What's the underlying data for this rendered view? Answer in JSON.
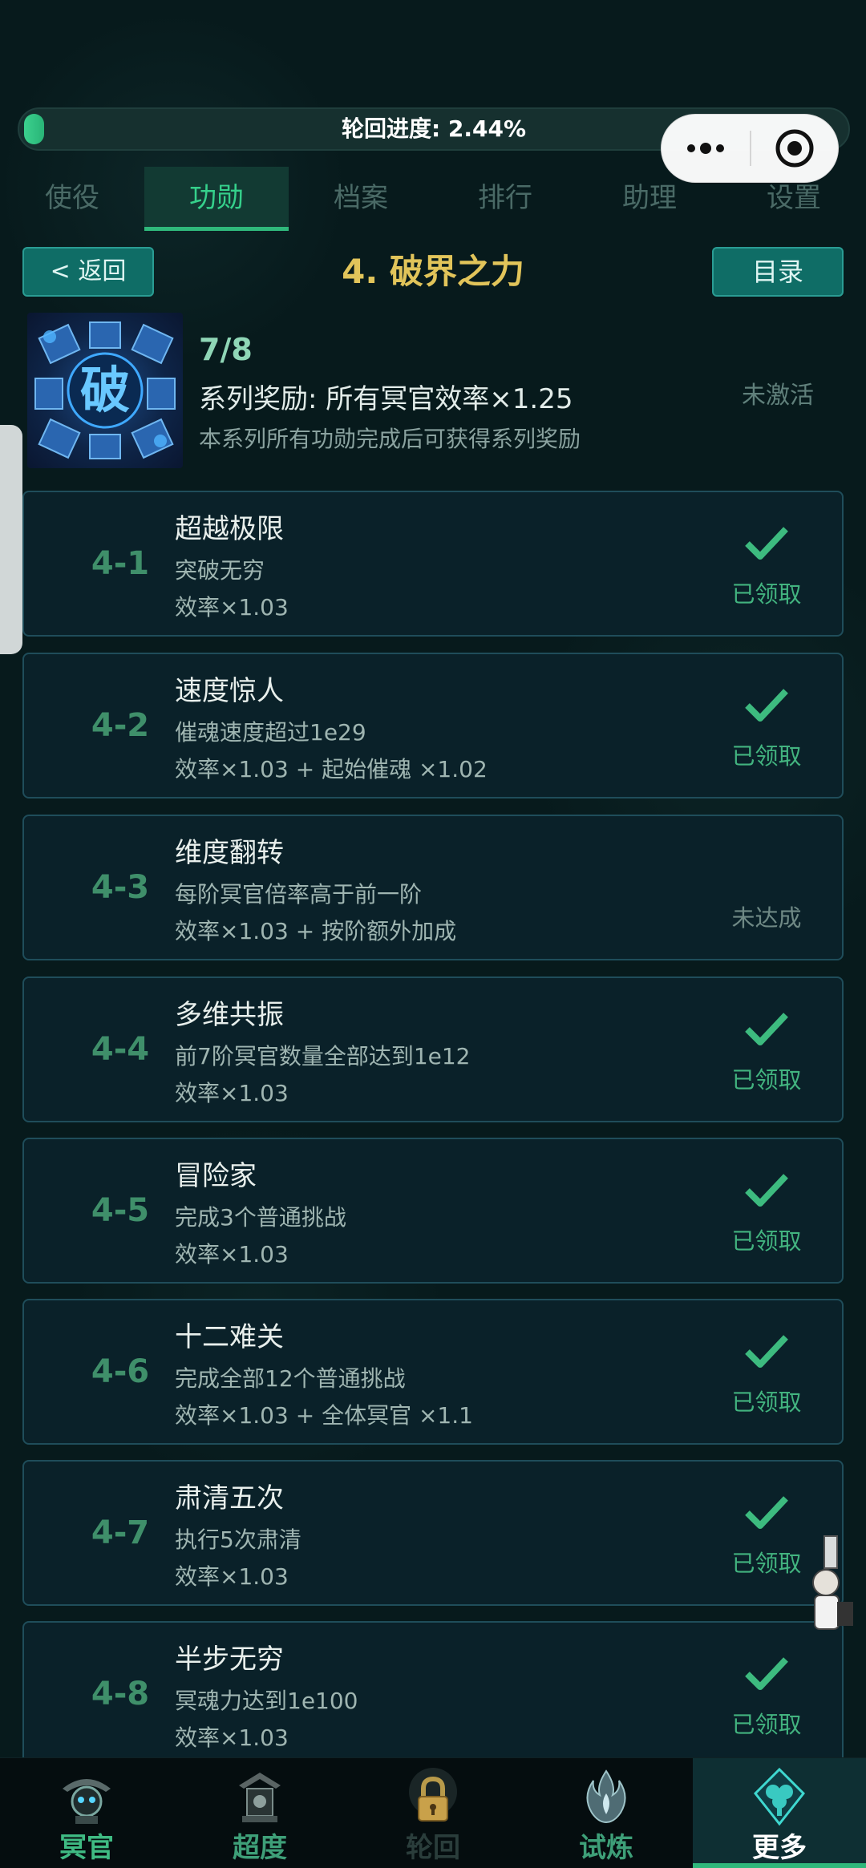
{
  "progress": {
    "label": "轮回进度: 2.44%",
    "fraction": 0.0244
  },
  "tabs": [
    {
      "label": "使役"
    },
    {
      "label": "功勋"
    },
    {
      "label": "档案"
    },
    {
      "label": "排行"
    },
    {
      "label": "助理"
    },
    {
      "label": "设置"
    }
  ],
  "header": {
    "back_label": "< 返回",
    "title": "4. 破界之力",
    "catalog_label": "目录"
  },
  "series": {
    "icon_text": "破",
    "count": "7/8",
    "reward": "系列奖励: 所有冥官效率×1.25",
    "desc": "本系列所有功勋完成后可获得系列奖励",
    "status": "未激活"
  },
  "achievements": [
    {
      "code": "4-1",
      "name": "超越极限",
      "condition": "突破无穷",
      "effect": "效率×1.03",
      "status": "已领取",
      "claimed": true
    },
    {
      "code": "4-2",
      "name": "速度惊人",
      "condition": "催魂速度超过1e29",
      "effect": "效率×1.03 + 起始催魂 ×1.02",
      "status": "已领取",
      "claimed": true
    },
    {
      "code": "4-3",
      "name": "维度翻转",
      "condition": "每阶冥官倍率高于前一阶",
      "effect": "效率×1.03 + 按阶额外加成",
      "status": "未达成",
      "claimed": false
    },
    {
      "code": "4-4",
      "name": "多维共振",
      "condition": "前7阶冥官数量全部达到1e12",
      "effect": "效率×1.03",
      "status": "已领取",
      "claimed": true
    },
    {
      "code": "4-5",
      "name": "冒险家",
      "condition": "完成3个普通挑战",
      "effect": "效率×1.03",
      "status": "已领取",
      "claimed": true
    },
    {
      "code": "4-6",
      "name": "十二难关",
      "condition": "完成全部12个普通挑战",
      "effect": "效率×1.03 + 全体冥官 ×1.1",
      "status": "已领取",
      "claimed": true
    },
    {
      "code": "4-7",
      "name": "肃清五次",
      "condition": "执行5次肃清",
      "effect": "效率×1.03",
      "status": "已领取",
      "claimed": true
    },
    {
      "code": "4-8",
      "name": "半步无穷",
      "condition": "冥魂力达到1e100",
      "effect": "效率×1.03",
      "status": "已领取",
      "claimed": true
    }
  ],
  "bottom_nav": [
    {
      "label": "冥官",
      "icon": "guan-icon"
    },
    {
      "label": "超度",
      "icon": "chaodu-icon"
    },
    {
      "label": "轮回",
      "icon": "lock-icon",
      "locked": true
    },
    {
      "label": "试炼",
      "icon": "flame-icon"
    },
    {
      "label": "更多",
      "icon": "more-icon",
      "active": true
    }
  ],
  "colors": {
    "accent_green": "#35d08b",
    "title_gold": "#e1c45a",
    "button_teal": "#0f6d66",
    "card_bg": "#0a2129"
  }
}
